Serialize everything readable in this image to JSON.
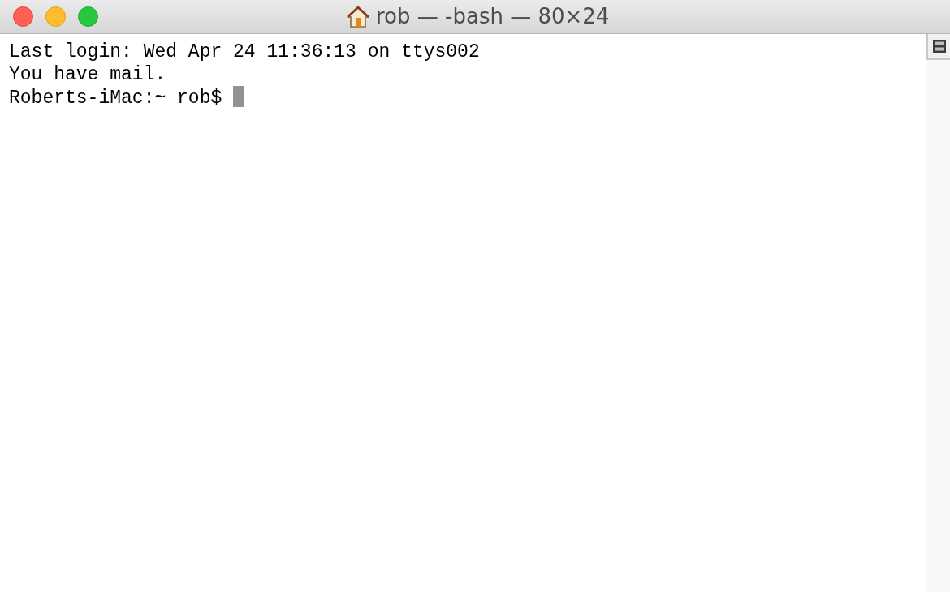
{
  "window": {
    "title": "rob — -bash — 80×24"
  },
  "terminal": {
    "lines": [
      "Last login: Wed Apr 24 11:36:13 on ttys002",
      "You have mail."
    ],
    "prompt": "Roberts-iMac:~ rob$"
  }
}
